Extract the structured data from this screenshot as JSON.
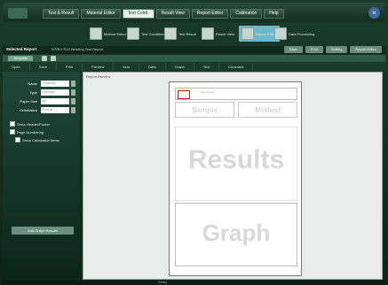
{
  "menu": [
    "Test & Result",
    "Material Editor",
    "Test Cond.",
    "Result View",
    "Report Editor",
    "Calibration",
    "Help"
  ],
  "active_menu_index": 2,
  "toolbar": {
    "items": [
      {
        "label": "Method\nEditor"
      },
      {
        "label": "Test\nConditions"
      },
      {
        "label": "Test\nResult"
      },
      {
        "label": "Result\nView"
      },
      {
        "label": "Report Editor"
      },
      {
        "label": "Data\nProcessing"
      }
    ],
    "selected_index": 4
  },
  "info": {
    "label": "Selected Report",
    "value": "NTRIO R12 Bending Test Report"
  },
  "top_actions": [
    "Save",
    "Print",
    "Setting",
    "Report Editor"
  ],
  "tab": {
    "label": "Template"
  },
  "subtoolbar": [
    "Open",
    "Save",
    "Print",
    "Preview",
    "Item",
    "Data",
    "Graph",
    "Text",
    "Comment"
  ],
  "leftpanel": {
    "fields": [
      {
        "label": "Name",
        "value": "Customer"
      },
      {
        "label": "Type",
        "value": "Standard"
      },
      {
        "label": "Paper Size",
        "value": "A4"
      },
      {
        "label": "Orientation",
        "value": "Portrait"
      }
    ],
    "checkboxes": [
      "Show Header/Footer",
      "Page Numbering",
      "Show Calculation Items"
    ],
    "button": "Add Graph Results"
  },
  "main": {
    "title": "Report Preview",
    "header_text": "Test Report",
    "sub_box_1": "Sample",
    "sub_box_2": "Method",
    "results_text": "Results",
    "graph_text": "Graph"
  },
  "status": "Ready"
}
